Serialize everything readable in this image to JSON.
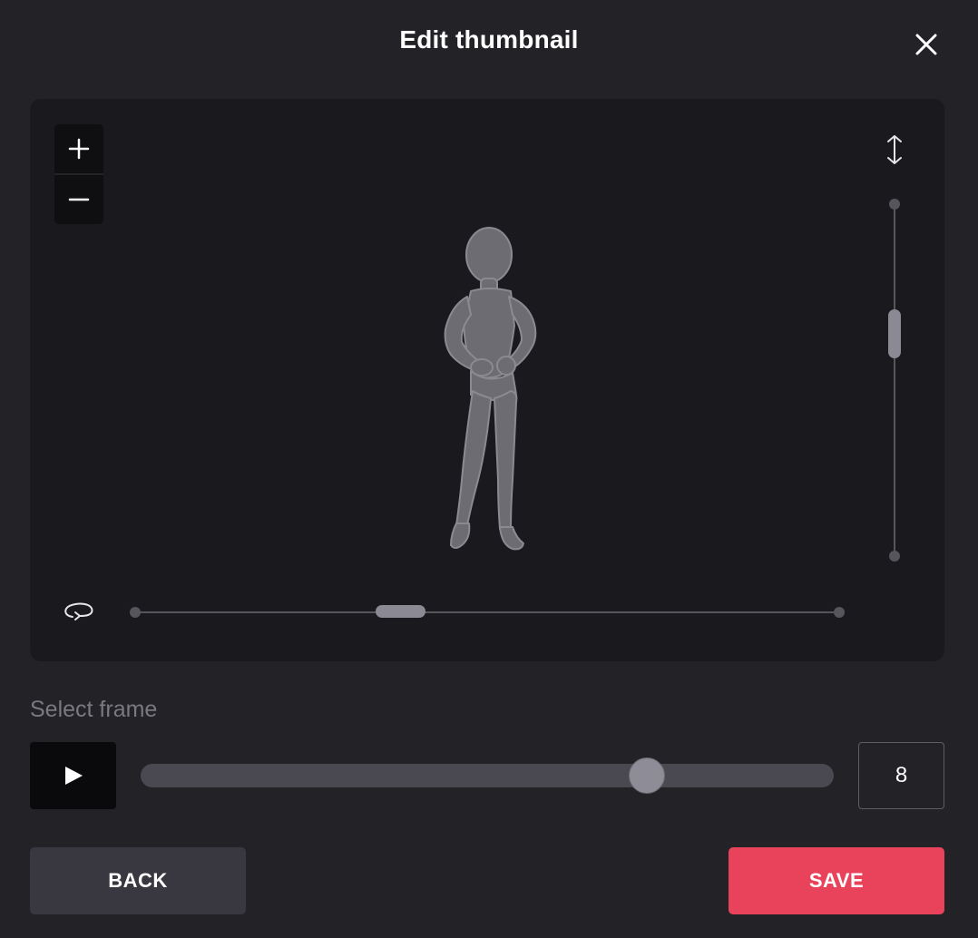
{
  "dialog": {
    "title": "Edit thumbnail"
  },
  "viewport": {
    "zoom_in_icon": "plus-icon",
    "zoom_out_icon": "minus-icon",
    "vertical_icon": "vertical-arrows-icon",
    "rotate_icon": "rotate-icon",
    "vertical_position": 0.37,
    "rotation_position": 0.38
  },
  "frame": {
    "label": "Select frame",
    "play_icon": "play-icon",
    "value": "8",
    "slider_position": 0.73
  },
  "footer": {
    "back_label": "BACK",
    "save_label": "SAVE"
  },
  "colors": {
    "background": "#232227",
    "viewport": "#1a191e",
    "accent": "#e8435a",
    "secondary_button": "#393840"
  }
}
